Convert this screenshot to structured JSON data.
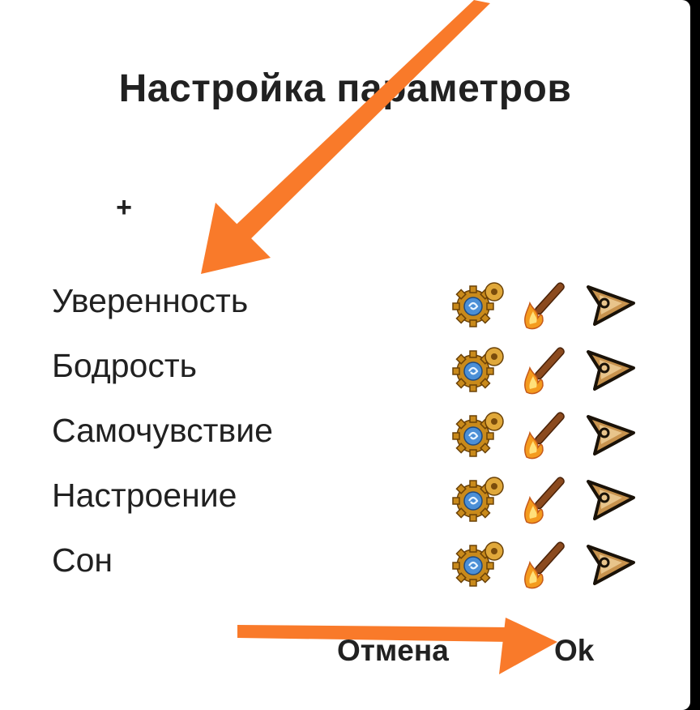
{
  "dialog": {
    "title": "Настройка параметров",
    "add_label": "+",
    "rows": [
      {
        "label": "Уверенность"
      },
      {
        "label": "Бодрость"
      },
      {
        "label": "Самочувствие"
      },
      {
        "label": "Настроение"
      },
      {
        "label": "Сон"
      }
    ],
    "row_icons": [
      "settings-gear-icon",
      "torch-edit-icon",
      "arrow-next-icon"
    ],
    "cancel_label": "Отмена",
    "ok_label": "Ok"
  },
  "annotations": {
    "arrow_color": "#F97A2A"
  }
}
